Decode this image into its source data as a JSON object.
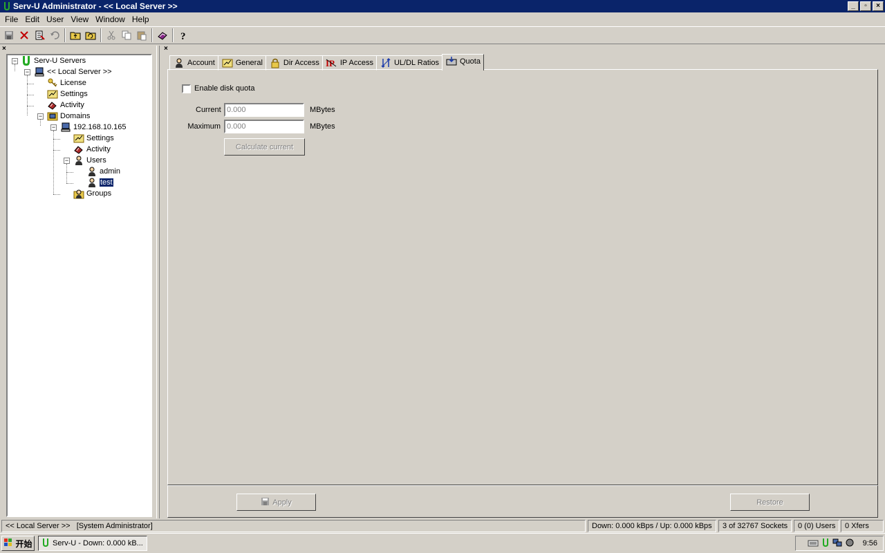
{
  "window": {
    "title": "Serv-U Administrator - << Local Server >>"
  },
  "menu": [
    "File",
    "Edit",
    "User",
    "View",
    "Window",
    "Help"
  ],
  "tree": {
    "root": "Serv-U Servers",
    "server": "<< Local Server >>",
    "license": "License",
    "settings": "Settings",
    "activity": "Activity",
    "domains": "Domains",
    "domain_ip": "192.168.10.165",
    "domain_settings": "Settings",
    "domain_activity": "Activity",
    "users": "Users",
    "user_admin": "admin",
    "user_test": "test",
    "groups": "Groups"
  },
  "tabs": [
    "Account",
    "General",
    "Dir Access",
    "IP Access",
    "UL/DL Ratios",
    "Quota"
  ],
  "quota": {
    "enable_label": "Enable disk quota",
    "enabled": false,
    "current_label": "Current",
    "current_value": "0.000",
    "maximum_label": "Maximum",
    "maximum_value": "0.000",
    "unit": "MBytes",
    "calculate_button": "Calculate current"
  },
  "buttons": {
    "apply": "Apply",
    "restore": "Restore"
  },
  "status": {
    "server": "<< Local Server >>",
    "role": "[System Administrator]",
    "speed": "Down: 0.000 kBps / Up: 0.000 kBps",
    "sockets": "3 of 32767 Sockets",
    "users": "0 (0) Users",
    "xfers": "0 Xfers"
  },
  "taskbar": {
    "start": "开始",
    "task": "Serv-U - Down: 0.000 kB...",
    "clock": "9:56"
  },
  "colors": {
    "selection": "#0a246a",
    "face": "#d4d0c8"
  }
}
